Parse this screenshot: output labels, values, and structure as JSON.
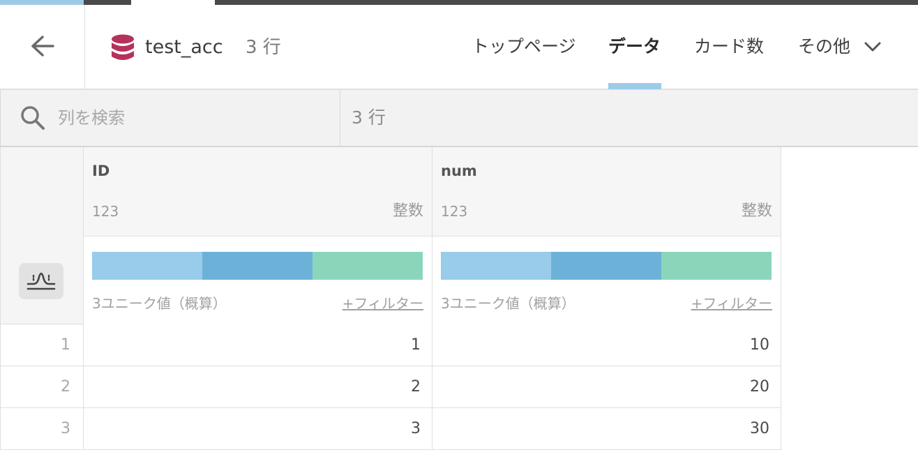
{
  "colors": {
    "accent_tab": "#9ccbe8",
    "dataset_icon": "#b5325a",
    "bar_light_blue": "#99cbea",
    "bar_blue": "#6cb2d8",
    "bar_green": "#8bd6bb",
    "top_strip_blue": "#9ccbe8",
    "top_strip_dark": "#4a4a4a"
  },
  "header": {
    "back_icon": "arrow-left-icon",
    "dataset_icon": "database-icon",
    "dataset_name": "test_acc",
    "row_count": "3 行",
    "tabs": [
      {
        "label": "トップページ",
        "active": false
      },
      {
        "label": "データ",
        "active": true
      },
      {
        "label": "カード数",
        "active": false
      },
      {
        "label": "その他",
        "active": false
      }
    ],
    "more_icon": "chevron-down-icon"
  },
  "toolbar": {
    "search_icon": "search-icon",
    "search_placeholder": "列を検索",
    "row_count": "3 行"
  },
  "grid": {
    "distribution_icon": "distribution-icon",
    "columns": [
      {
        "name": "ID",
        "type_code": "123",
        "type_name": "整数",
        "unique_text": "3ユニーク値（概算）",
        "filter_label": "+フィルター"
      },
      {
        "name": "num",
        "type_code": "123",
        "type_name": "整数",
        "unique_text": "3ユニーク値（概算）",
        "filter_label": "+フィルター"
      }
    ],
    "rows": [
      {
        "num": "1",
        "cells": [
          "1",
          "10"
        ]
      },
      {
        "num": "2",
        "cells": [
          "2",
          "20"
        ]
      },
      {
        "num": "3",
        "cells": [
          "3",
          "30"
        ]
      }
    ]
  }
}
